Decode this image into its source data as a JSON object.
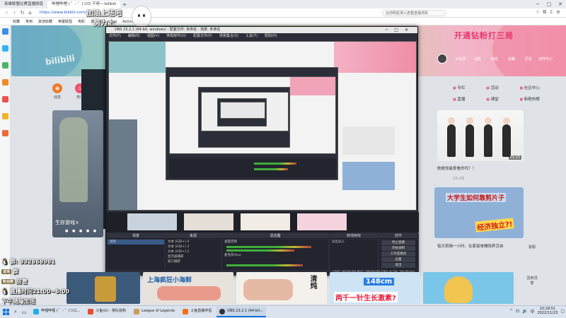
{
  "browser": {
    "tabs": [
      {
        "label": "英雄联盟比赛直播频道",
        "active": false
      },
      {
        "label": "哔哩哔哩 ( ゜- ゜)つロ 干杯~-bilibili",
        "active": true
      }
    ],
    "url": "https://www.bilibili.com/",
    "search_placeholder": "台前明星演入皮套直播求取",
    "bookmarks": [
      "收藏",
      "常用",
      "其他收藏",
      "英雄联盟",
      "电影",
      "游戏直播 - Leag",
      "ActiveS精品游戏"
    ]
  },
  "site": {
    "logo_text": "bilibili",
    "promo": "开通钻粉打三局",
    "top_icons": [
      "大会员",
      "消息",
      "动态",
      "收藏",
      "历史",
      "创作中心"
    ],
    "subnav": [
      {
        "label": "动态",
        "color": "#f07a2a"
      },
      {
        "label": "热门",
        "color": "#f2506b"
      }
    ],
    "right_links": [
      "专栏",
      "活动",
      "社区中心",
      "直播",
      "课堂",
      "新歌热榜"
    ],
    "dance_duration": "01:23",
    "dance_title": "她是你最爱看的吗？！",
    "dance_meta": "10-29",
    "student_title": "大学生如何靠剪片子",
    "student_sub": "经济独立?!",
    "student_caption": "每天剪辑一小时，在家接单赚钱养活自",
    "float_labels": [
      "客服",
      "回到顶部"
    ],
    "game_tile_label": "生存游戏×"
  },
  "stickers": {
    "top_line1": "加油上班吧",
    "top_line2": "努力上"
  },
  "obs": {
    "title": "OBS 23.2.1 (64-bit, windows) - 配置文件: 未命名 - 场景: 未命名",
    "menu": [
      "文件(F)",
      "编辑(E)",
      "视图(V)",
      "停靠部件(D)",
      "配置文件(P)",
      "场景集合(S)",
      "工具(T)",
      "帮助(H)"
    ],
    "docks": [
      {
        "title": "场景",
        "rows": [
          "场景"
        ]
      },
      {
        "title": "来源",
        "rows": [
          "文本 (GDI+) 4",
          "文本 (GDI+) 3",
          "文本 (GDI+) 2",
          "显示器捕获",
          "窗口捕获"
        ]
      },
      {
        "title": "混音器",
        "rows": [
          "桌面音频",
          "麦克风/Aux"
        ]
      },
      {
        "title": "转场特效",
        "rows": [
          "淡出淡入"
        ]
      },
      {
        "title": "控件",
        "rows": [
          "停止直播",
          "开始录制",
          "工作室模式",
          "设置",
          "退出"
        ]
      }
    ],
    "status": "LIVE: 00:00:00   REC: 00:00:00   CPU: 6.2%, 30.00 fps"
  },
  "overlay": {
    "qq_group": "群: 832868981",
    "entry_badge": "进场",
    "entry_text": "群",
    "fans_badge": "粉丝群",
    "fans_text": "房管",
    "schedule": "直播时间21:00~6:00",
    "schedule2": "下午随缘加班"
  },
  "thumbs": [
    {
      "caption": "",
      "color": "#3c5a7a"
    },
    {
      "caption": "上海疯狂小海鲜",
      "color": "#e7e2dc"
    },
    {
      "caption": "清炖",
      "color": "#f4f1ec"
    },
    {
      "caption": "148cm",
      "color": "#cde4f5"
    },
    {
      "caption": "两千一针生长激素?",
      "color": "#f5d6e0"
    },
    {
      "caption": "",
      "color": "#7ac6e8"
    }
  ],
  "taskbar": {
    "tasks": [
      {
        "label": "哔哩哔哩 ( ゜- ゜)つロ...",
        "color": "#1faeea",
        "active": false
      },
      {
        "label": "斗鱼(G) - 排队抢购",
        "color": "#e94b2b",
        "active": false
      },
      {
        "label": "League of Legends",
        "color": "#c7a054",
        "active": false
      },
      {
        "label": "斗鱼直播伴侣",
        "color": "#f37021",
        "active": false
      },
      {
        "label": "OBS 23.2.1 (64-bit...",
        "color": "#333",
        "active": true
      }
    ],
    "time": "10:29:51",
    "date": "2022/11/23"
  }
}
